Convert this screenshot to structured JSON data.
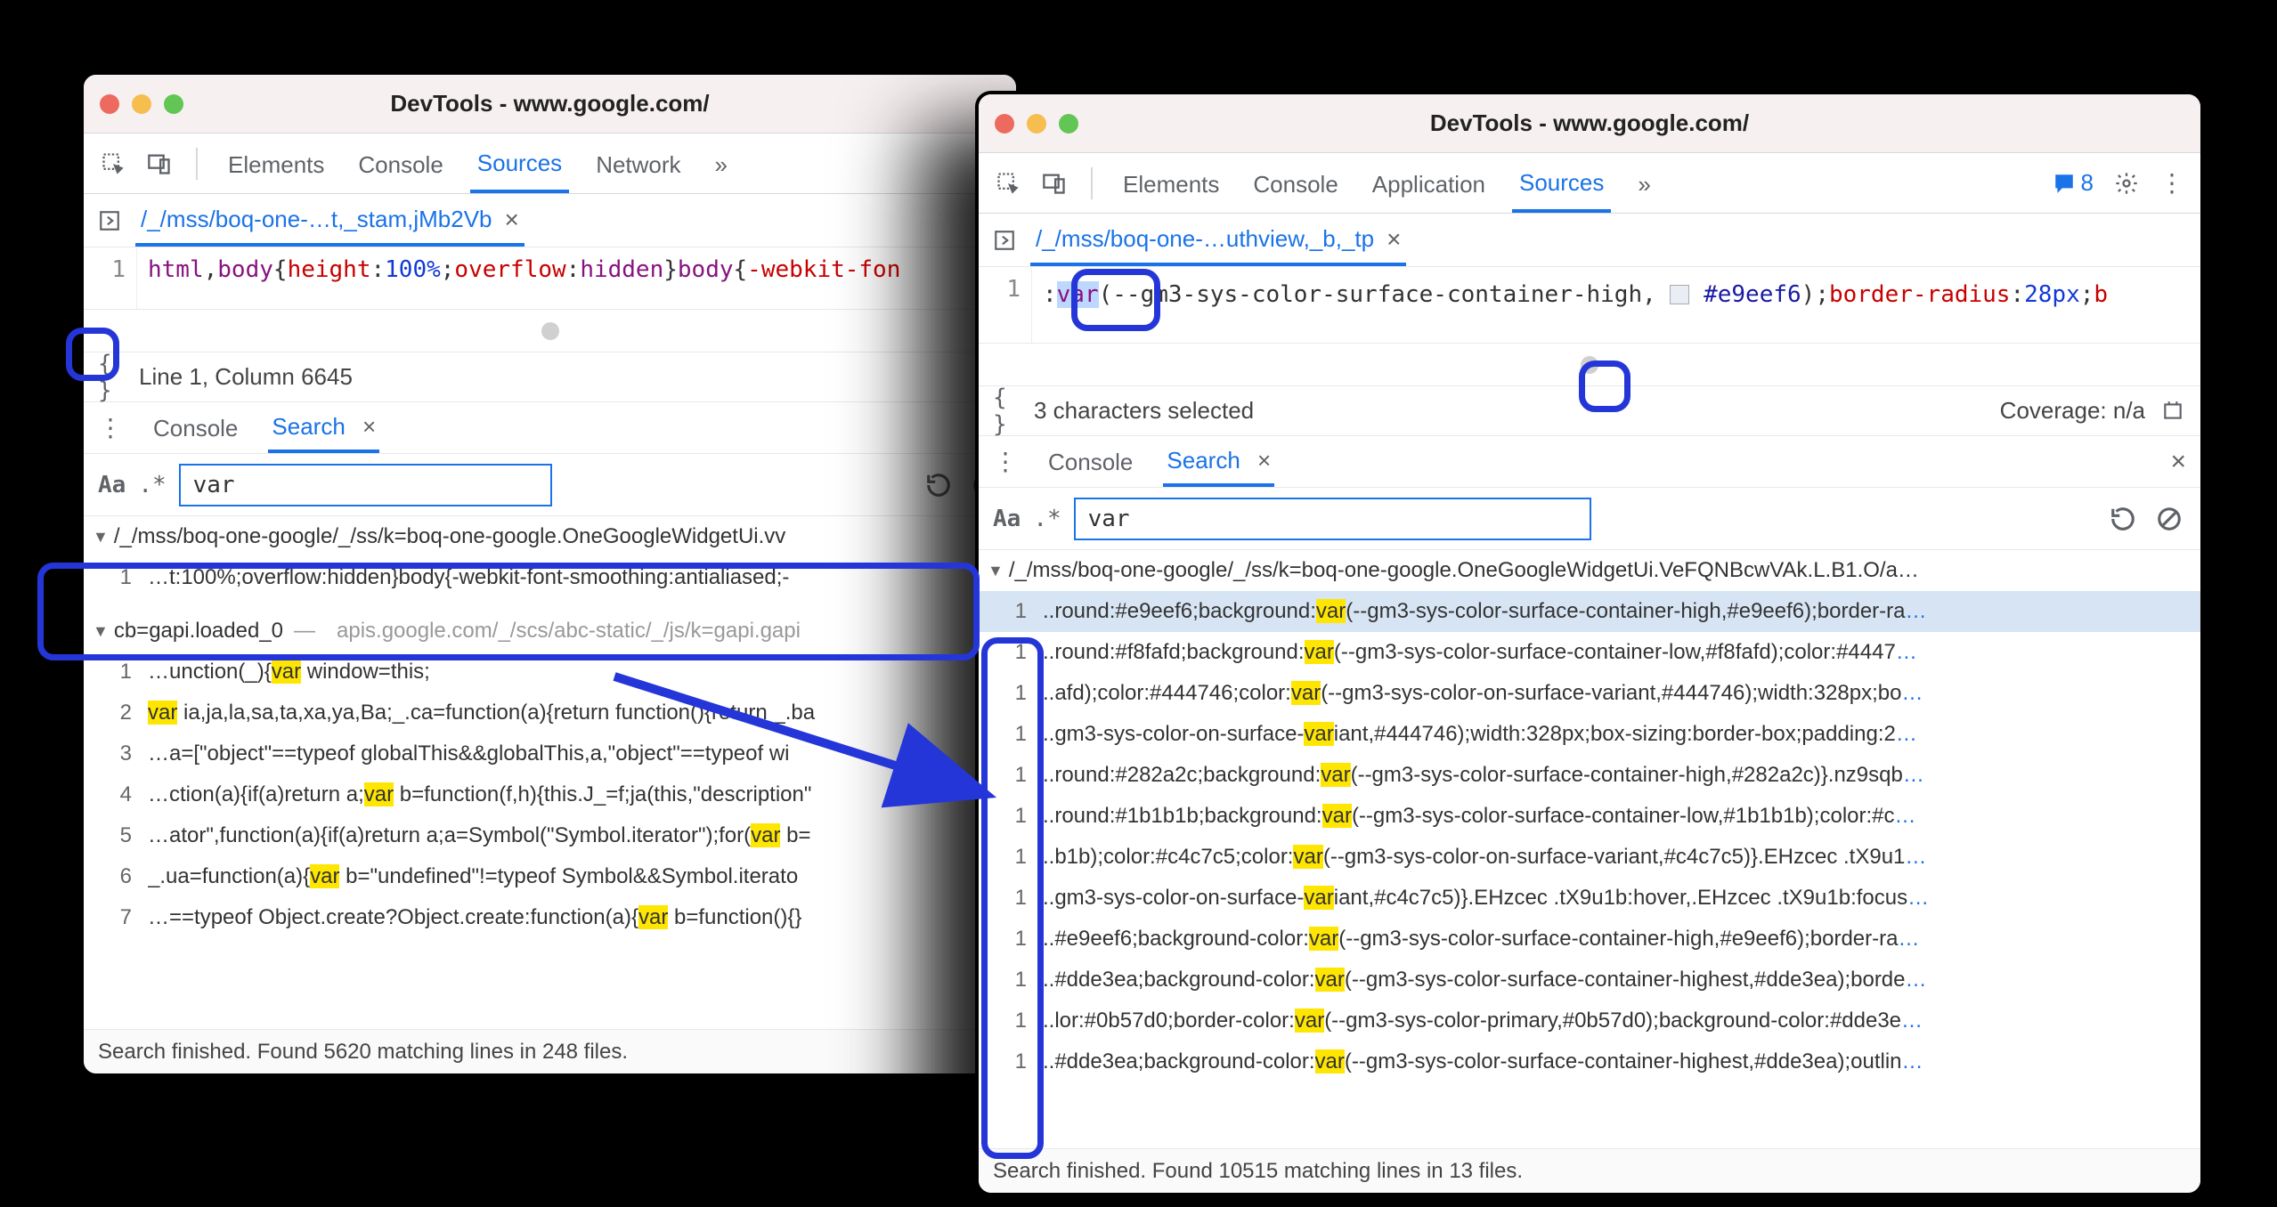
{
  "left": {
    "title": "DevTools - www.google.com/",
    "tabs": {
      "elements": "Elements",
      "console": "Console",
      "sources": "Sources",
      "network": "Network",
      "more": "»"
    },
    "file_tab": "/_/mss/boq-one-…t,_stam,jMb2Vb",
    "code": {
      "ln": "1",
      "seg_tag": "html",
      "seg_comma1": ",",
      "seg_body": "body",
      "seg_ob": "{",
      "seg_height": "height",
      "seg_colon": ":",
      "seg_100": "100%",
      "seg_semi": ";",
      "seg_overflow": "overflow",
      "seg_hidden": "hidden",
      "seg_cb": "}",
      "seg_body2": "body",
      "seg_ob2": "{",
      "seg_webkit": "-webkit-fon"
    },
    "status": "Line 1, Column 6645",
    "drawer": {
      "console": "Console",
      "search": "Search"
    },
    "search_query": "var",
    "aa": "Aa",
    "regex": ".*",
    "results": {
      "file1_path": "/_/mss/boq-one-google/_/ss/k=boq-one-google.OneGoogleWidgetUi.vv",
      "file1_lines": [
        {
          "ln": "1",
          "pre": "…t:100%;overflow:hidden}body{-webkit-font-smoothing:antialiased;-",
          "hl": "",
          "post": ""
        }
      ],
      "file2_name": "cb=gapi.loaded_0",
      "file2_origin": "apis.google.com/_/scs/abc-static/_/js/k=gapi.gapi",
      "file2_lines": [
        {
          "ln": "1",
          "pre": "…unction(_){",
          "hl": "var",
          "post": " window=this;"
        },
        {
          "ln": "2",
          "pre": "",
          "hl": "var",
          "post": " ia,ja,la,sa,ta,xa,ya,Ba;_.ca=function(a){return function(){return _.ba"
        },
        {
          "ln": "3",
          "pre": "…a=[\"object\"==typeof globalThis&&globalThis,a,\"object\"==typeof wi",
          "hl": "",
          "post": ""
        },
        {
          "ln": "4",
          "pre": "…ction(a){if(a)return a;",
          "hl": "var",
          "post": " b=function(f,h){this.J_=f;ja(this,\"description\""
        },
        {
          "ln": "5",
          "pre": "…ator\",function(a){if(a)return a;a=Symbol(\"Symbol.iterator\");for(",
          "hl": "var",
          "post": " b="
        },
        {
          "ln": "6",
          "pre": "_.ua=function(a){",
          "hl": "var",
          "post": " b=\"undefined\"!=typeof Symbol&&Symbol.iterato"
        },
        {
          "ln": "7",
          "pre": "…==typeof Object.create?Object.create:function(a){",
          "hl": "var",
          "post": " b=function(){}"
        }
      ]
    },
    "footer": "Search finished.  Found 5620 matching lines in 248 files."
  },
  "right": {
    "title": "DevTools - www.google.com/",
    "tabs": {
      "elements": "Elements",
      "console": "Console",
      "application": "Application",
      "sources": "Sources",
      "more": "»"
    },
    "msg_count": "8",
    "file_tab": "/_/mss/boq-one-…uthview,_b,_tp",
    "code": {
      "ln": "1",
      "seg_colon": ":",
      "seg_var": "var",
      "seg_open": "(",
      "seg_name": "--gm3-sys-color-surface-container-high",
      "seg_comma": ",",
      "seg_hex_swatch": "#e9eef6",
      "seg_hex": "#e9eef6",
      "seg_close": ")",
      "seg_semi": ";",
      "seg_border": "border-radius",
      "seg_28": "28px",
      "seg_semi2": ";",
      "seg_b": "b"
    },
    "status_left": "3 characters selected",
    "status_right": "Coverage: n/a",
    "drawer": {
      "console": "Console",
      "search": "Search"
    },
    "search_query": "var",
    "aa": "Aa",
    "regex": ".*",
    "results": {
      "file1_path": "/_/mss/boq-one-google/_/ss/k=boq-one-google.OneGoogleWidgetUi.VeFQNBcwVAk.L.B1.O/a…",
      "lines": [
        {
          "ln": "1",
          "pre": "..round:#e9eef6;background:",
          "hl": "var",
          "post": "(--gm3-sys-color-surface-container-high,#e9eef6);border-ra",
          "ell": "…",
          "sel": true
        },
        {
          "ln": "1",
          "pre": "..round:#f8fafd;background:",
          "hl": "var",
          "post": "(--gm3-sys-color-surface-container-low,#f8fafd);color:#4447",
          "ell": "…"
        },
        {
          "ln": "1",
          "pre": "..afd);color:#444746;color:",
          "hl": "var",
          "post": "(--gm3-sys-color-on-surface-variant,#444746);width:328px;bo",
          "ell": "…"
        },
        {
          "ln": "1",
          "pre": "..gm3-sys-color-on-surface-",
          "hl": "var",
          "post": "iant,#444746);width:328px;box-sizing:border-box;padding:2",
          "ell": "…"
        },
        {
          "ln": "1",
          "pre": "..round:#282a2c;background:",
          "hl": "var",
          "post": "(--gm3-sys-color-surface-container-high,#282a2c)}.nz9sqb",
          "ell": "…"
        },
        {
          "ln": "1",
          "pre": "..round:#1b1b1b;background:",
          "hl": "var",
          "post": "(--gm3-sys-color-surface-container-low,#1b1b1b);color:#c",
          "ell": "…"
        },
        {
          "ln": "1",
          "pre": "..b1b);color:#c4c7c5;color:",
          "hl": "var",
          "post": "(--gm3-sys-color-on-surface-variant,#c4c7c5)}.EHzcec .tX9u1",
          "ell": "…"
        },
        {
          "ln": "1",
          "pre": "..gm3-sys-color-on-surface-",
          "hl": "var",
          "post": "iant,#c4c7c5)}.EHzcec .tX9u1b:hover,.EHzcec .tX9u1b:focus",
          "ell": "…"
        },
        {
          "ln": "1",
          "pre": "..#e9eef6;background-color:",
          "hl": "var",
          "post": "(--gm3-sys-color-surface-container-high,#e9eef6);border-ra",
          "ell": "…"
        },
        {
          "ln": "1",
          "pre": "..#dde3ea;background-color:",
          "hl": "var",
          "post": "(--gm3-sys-color-surface-container-highest,#dde3ea);borde",
          "ell": "…"
        },
        {
          "ln": "1",
          "pre": "..lor:#0b57d0;border-color:",
          "hl": "var",
          "post": "(--gm3-sys-color-primary,#0b57d0);background-color:#dde3e",
          "ell": "…"
        },
        {
          "ln": "1",
          "pre": "..#dde3ea;background-color:",
          "hl": "var",
          "post": "(--gm3-sys-color-surface-container-highest,#dde3ea);outlin",
          "ell": "…"
        }
      ]
    },
    "footer": "Search finished.  Found 10515 matching lines in 13 files."
  }
}
